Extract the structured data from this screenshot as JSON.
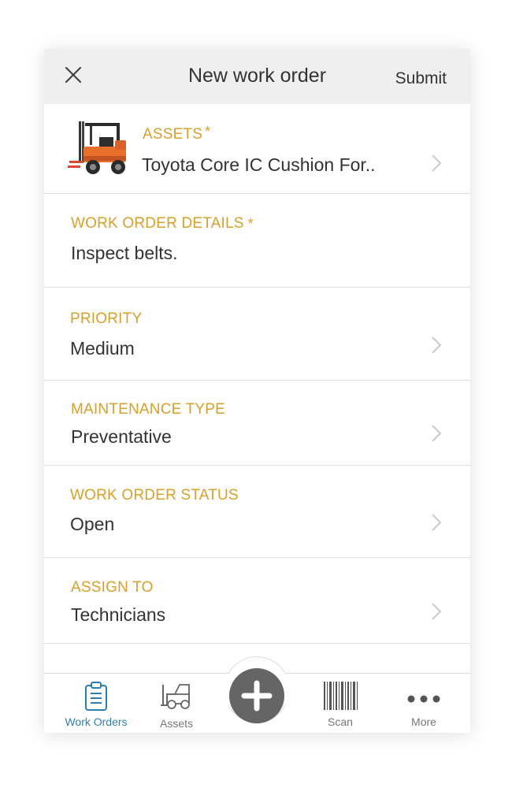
{
  "header": {
    "title": "New work order",
    "submit_label": "Submit"
  },
  "fields": {
    "assets": {
      "label": "ASSETS",
      "required_mark": "*",
      "value": "Toyota Core IC Cushion For.."
    },
    "details": {
      "label": "WORK ORDER DETAILS",
      "required_mark": "*",
      "value": "Inspect belts."
    },
    "priority": {
      "label": "PRIORITY",
      "value": "Medium"
    },
    "maintenance_type": {
      "label": "MAINTENANCE TYPE",
      "value": "Preventative"
    },
    "status": {
      "label": "WORK ORDER STATUS",
      "value": "Open"
    },
    "assign_to": {
      "label": "ASSIGN TO",
      "value": "Technicians"
    }
  },
  "tabbar": {
    "work_orders": {
      "label": "Work Orders",
      "icon": "clipboard-icon",
      "active": true
    },
    "assets": {
      "label": "Assets",
      "icon": "forklift-icon"
    },
    "add": {
      "icon": "plus-icon"
    },
    "scan": {
      "label": "Scan",
      "icon": "barcode-icon"
    },
    "more": {
      "label": "More",
      "icon": "ellipsis-icon"
    }
  },
  "colors": {
    "accent": "#d8a02a",
    "active_tab": "#2a7fb0",
    "fab": "#656565",
    "header_bg": "#efefef"
  }
}
